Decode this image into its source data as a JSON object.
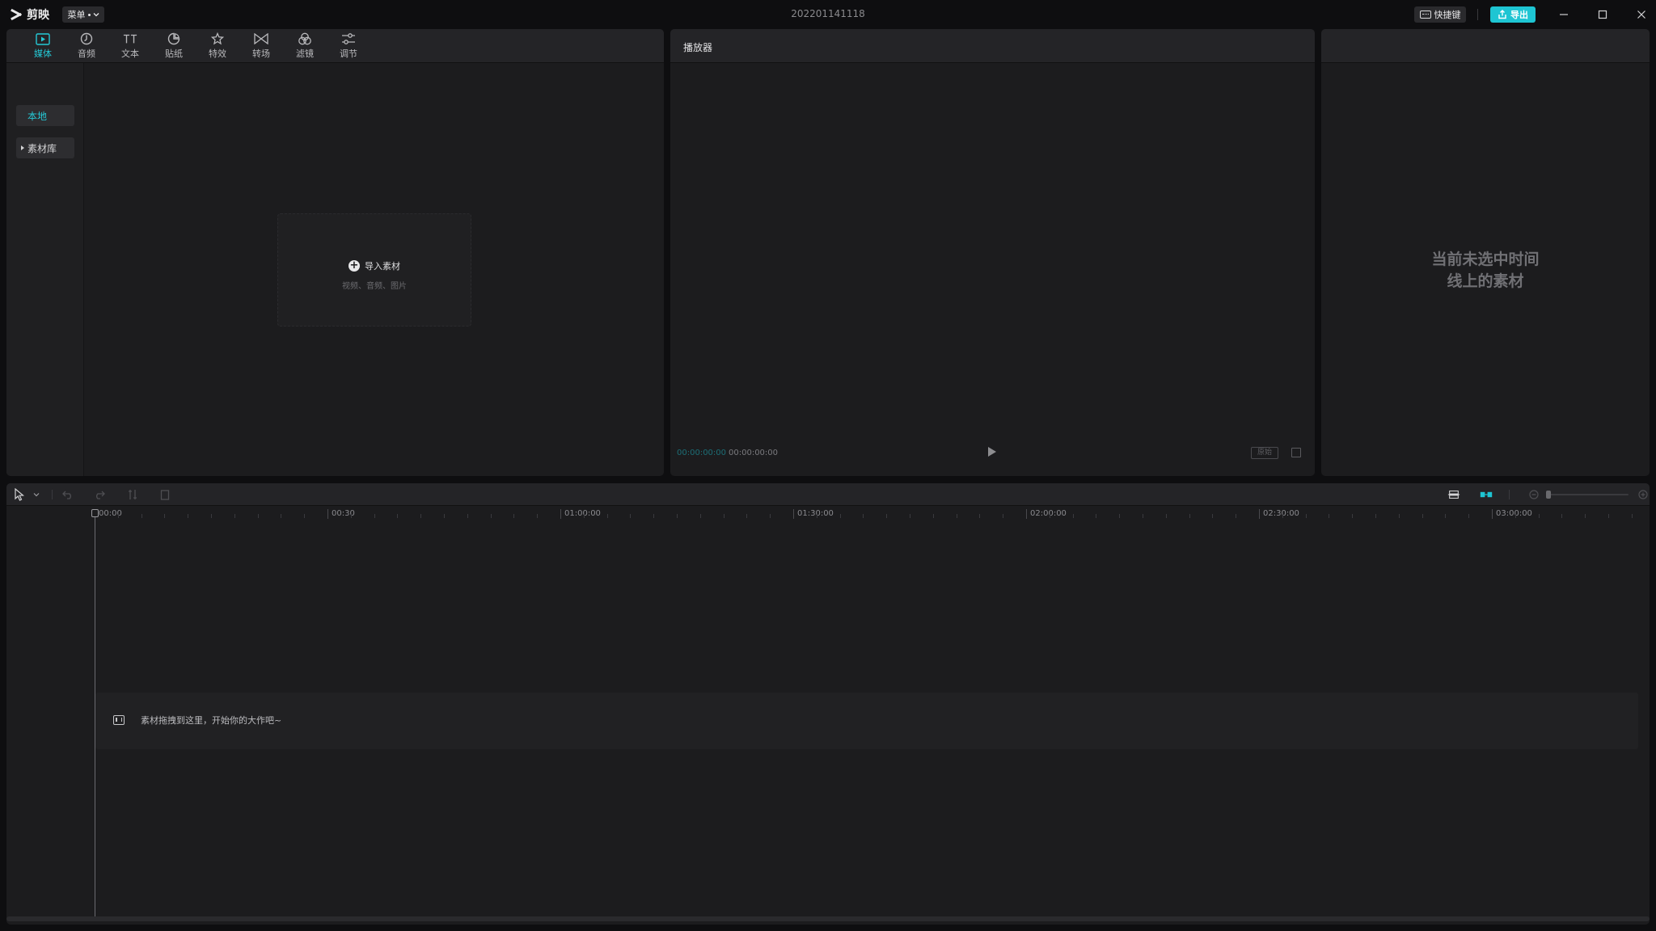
{
  "app": {
    "name": "剪映",
    "menu_label": "菜单",
    "project_title": "202201141118",
    "shortcut_label": "快捷键",
    "export_label": "导出"
  },
  "media_tabs": [
    {
      "label": "媒体",
      "icon": "media-play-icon",
      "active": true
    },
    {
      "label": "音频",
      "icon": "audio-icon",
      "active": false
    },
    {
      "label": "文本",
      "icon": "text-icon",
      "active": false
    },
    {
      "label": "贴纸",
      "icon": "sticker-icon",
      "active": false
    },
    {
      "label": "特效",
      "icon": "effects-icon",
      "active": false
    },
    {
      "label": "转场",
      "icon": "transition-icon",
      "active": false
    },
    {
      "label": "滤镜",
      "icon": "filter-icon",
      "active": false
    },
    {
      "label": "调节",
      "icon": "adjust-icon",
      "active": false
    }
  ],
  "sidebar": {
    "local": "本地",
    "library": "素材库"
  },
  "import": {
    "label": "导入素材",
    "sub": "视频、音频、图片"
  },
  "player": {
    "title": "播放器",
    "current_time": "00:00:00:00",
    "total_time": "00:00:00:00",
    "ratio_label": "原始"
  },
  "properties": {
    "empty_line1": "当前未选中时间",
    "empty_line2": "线上的素材"
  },
  "timeline": {
    "ruler_labels": [
      "00:00",
      "00:30",
      "01:00:00",
      "01:30:00",
      "02:00:00",
      "02:30:00",
      "03:00:00"
    ],
    "drop_hint": "素材拖拽到这里，开始你的大作吧~"
  },
  "colors": {
    "accent": "#1ec5d3",
    "background": "#0e0e10",
    "panel": "#1c1c1e"
  }
}
